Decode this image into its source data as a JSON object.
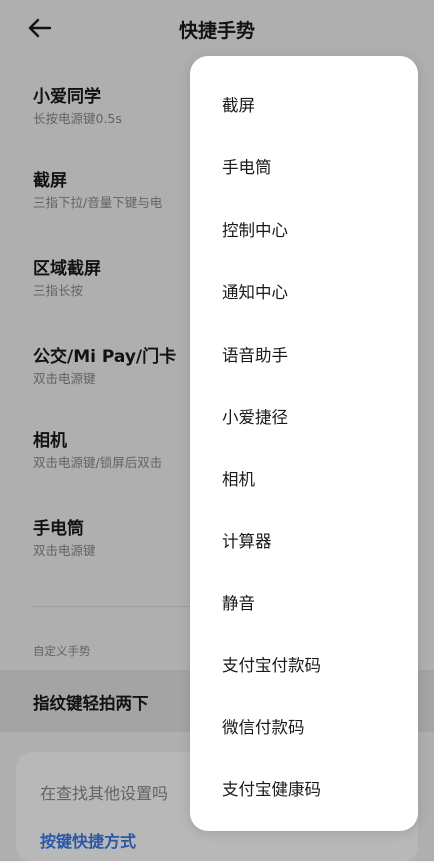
{
  "header": {
    "title": "快捷手势",
    "back_icon": "arrow-left-icon"
  },
  "settings": [
    {
      "title": "小爱同学",
      "subtitle": "长按电源键0.5s"
    },
    {
      "title": "截屏",
      "subtitle": "三指下拉/音量下键与电"
    },
    {
      "title": "区域截屏",
      "subtitle": "三指长按"
    },
    {
      "title": "公交/Mi Pay/门卡",
      "subtitle": "双击电源键"
    },
    {
      "title": "相机",
      "subtitle": "双击电源键/锁屏后双击"
    },
    {
      "title": "手电筒",
      "subtitle": "双击电源键"
    }
  ],
  "section_label": "自定义手势",
  "fingerprint_row": "指纹键轻拍两下",
  "card": {
    "question": "在查找其他设置吗",
    "link": "按键快捷方式"
  },
  "menu": {
    "items": [
      "截屏",
      "手电筒",
      "控制中心",
      "通知中心",
      "语音助手",
      "小爱捷径",
      "相机",
      "计算器",
      "静音",
      "支付宝付款码",
      "微信付款码",
      "支付宝健康码"
    ]
  },
  "colors": {
    "accent": "#3a7be8",
    "background": "#f3f3f3",
    "overlay": "rgba(0,0,0,0.28)"
  }
}
